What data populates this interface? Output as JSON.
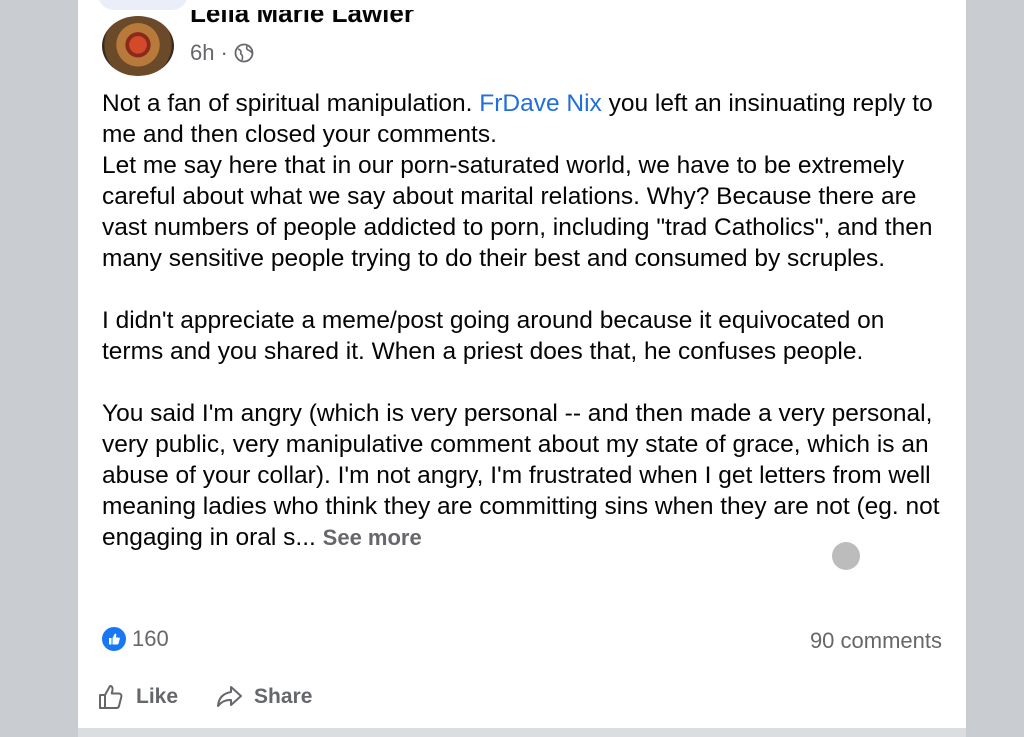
{
  "post": {
    "author": "Leila Marie Lawler",
    "time": "6h",
    "separator": "·",
    "privacy_icon": "globe-icon",
    "paragraphs": [
      {
        "before": "Not a fan of spiritual manipulation. ",
        "mention": "FrDave Nix",
        "after": " you left an insinuating reply to me and then closed your comments.\nLet me say here that in our porn-saturated world, we have to be extremely careful about what we say about marital relations. Why? Because there are vast numbers of people addicted to porn, including \"trad Catholics\", and then many sensitive people trying to do their best and consumed by scruples."
      },
      {
        "text": "I didn't appreciate a meme/post going around because it equivocated on terms and you shared it. When a priest does that, he confuses people."
      },
      {
        "text": "You said I'm angry (which is very personal -- and then made a very personal, very public, very manipulative comment about my state of grace, which is an abuse of your collar). I'm not angry, I'm frustrated when I get letters from well meaning ladies who think they are committing sins when they are not (eg. not engaging in oral s...",
        "see_more": "See more"
      }
    ],
    "reaction_count": "160",
    "reaction_icon": "like-reaction-icon",
    "comments": "90 comments",
    "actions": {
      "like": "Like",
      "share": "Share"
    }
  },
  "colors": {
    "background": "#c9ccd1",
    "card": "#ffffff",
    "text": "#050505",
    "secondary": "#65676b",
    "link": "#216fdb",
    "like_blue": "#1877f2"
  }
}
